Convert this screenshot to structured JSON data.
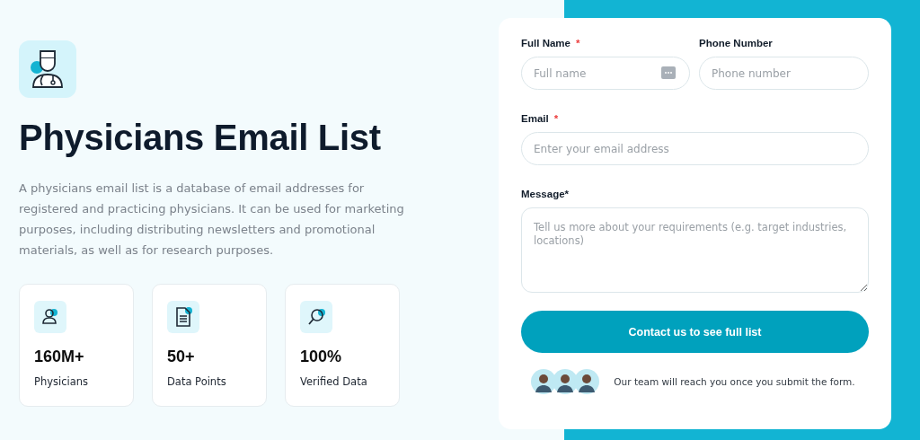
{
  "hero": {
    "title": "Physicians Email List",
    "description": "A physicians email list is a database of email addresses for registered and practicing physicians. It can be used for marketing purposes, including distributing newsletters and promotional materials, as well as for research purposes."
  },
  "stats": [
    {
      "kind": "person",
      "value": "160M+",
      "label": "Physicians"
    },
    {
      "kind": "document",
      "value": "50+",
      "label": "Data Points"
    },
    {
      "kind": "search",
      "value": "100%",
      "label": "Verified Data"
    }
  ],
  "form": {
    "fields": [
      {
        "kind": "text",
        "label": "Full Name",
        "required_mark": "*",
        "placeholder": "Full name",
        "autofill_icon": true
      },
      {
        "kind": "text",
        "label": "Phone Number",
        "placeholder": "Phone number",
        "autofill_icon": false
      },
      {
        "kind": "text",
        "label": "Email",
        "required_mark": "*",
        "placeholder": "Enter your email address",
        "autofill_icon": false
      },
      {
        "kind": "textarea",
        "label": "Message*",
        "placeholder": "Tell us more about your requirements (e.g. target industries, locations)"
      }
    ],
    "submit": "Contact us to see full list",
    "note": "Our team will reach you once you submit the form."
  }
}
